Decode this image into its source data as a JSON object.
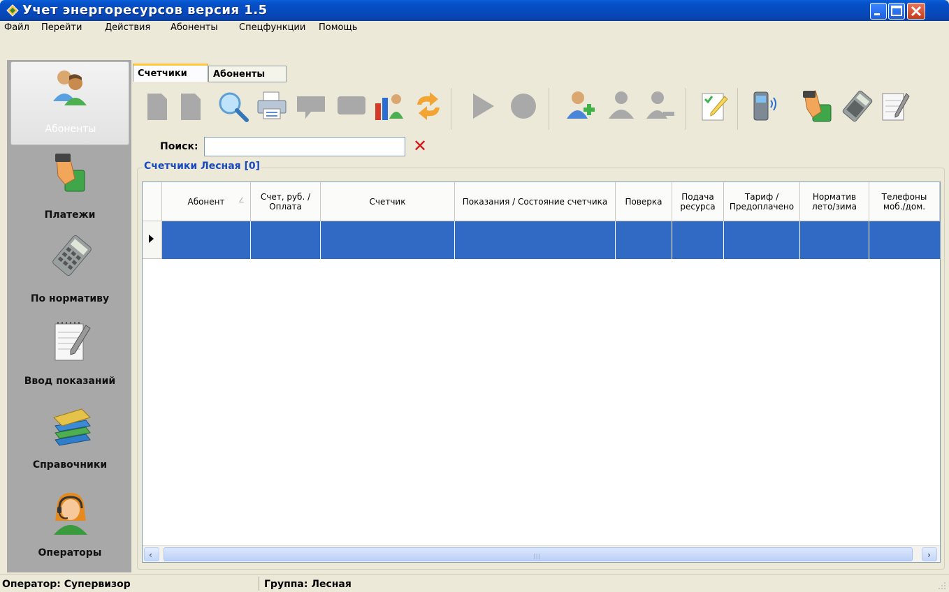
{
  "window": {
    "title": "Учет энергоресурсов версия 1.5"
  },
  "menu": [
    "Файл",
    "Перейти",
    "Действия",
    "Абоненты",
    "Спецфункции",
    "Помощь"
  ],
  "nav": [
    {
      "label": "Абоненты",
      "icon": "users-icon",
      "active": true
    },
    {
      "label": "Платежи",
      "icon": "payment-hand-icon",
      "active": false
    },
    {
      "label": "По нормативу",
      "icon": "calculator-icon",
      "active": false
    },
    {
      "label": "Ввод показаний",
      "icon": "notepad-pen-icon",
      "active": false
    },
    {
      "label": "Справочники",
      "icon": "books-icon",
      "active": false
    },
    {
      "label": "Операторы",
      "icon": "operator-headset-icon",
      "active": false
    }
  ],
  "tabs": [
    {
      "label": "Счетчики",
      "active": true
    },
    {
      "label": "Абоненты",
      "active": false
    }
  ],
  "toolbar": [
    "new-document-icon",
    "copy-document-icon",
    "search-magnifier-icon",
    "printer-icon",
    "comment-icon",
    "message-icon",
    "users-chart-icon",
    "refresh-arrows-icon",
    "play-icon",
    "record-icon",
    "add-user-icon",
    "user-icon",
    "remove-user-icon",
    "checklist-edit-icon",
    "phone-sms-icon",
    "payment-hand-icon",
    "calculator-icon",
    "notepad-pen-icon"
  ],
  "search": {
    "label": "Поиск:",
    "value": "",
    "clear_icon": "clear-x-icon"
  },
  "group": {
    "title": "Счетчики Лесная [0]"
  },
  "grid": {
    "columns": [
      "Абонент",
      "Счет, руб. / Оплата",
      "Счетчик",
      "Показания / Состояние счетчика",
      "Поверка",
      "Подача ресурса",
      "Тариф / Предоплачено",
      "Норматив лето/зима",
      "Телефоны моб./дом."
    ],
    "sort_column": "Абонент",
    "rows": [
      [
        "",
        "",
        "",
        "",
        "",
        "",
        "",
        "",
        ""
      ]
    ]
  },
  "status": {
    "operator": "Оператор: Супервизор",
    "group": "Группа: Лесная"
  },
  "colors": {
    "titlebar": "#0550c8",
    "selection": "#316ac5",
    "nav_bg": "#a8a8a8",
    "accent_tab": "#ffc83c"
  }
}
